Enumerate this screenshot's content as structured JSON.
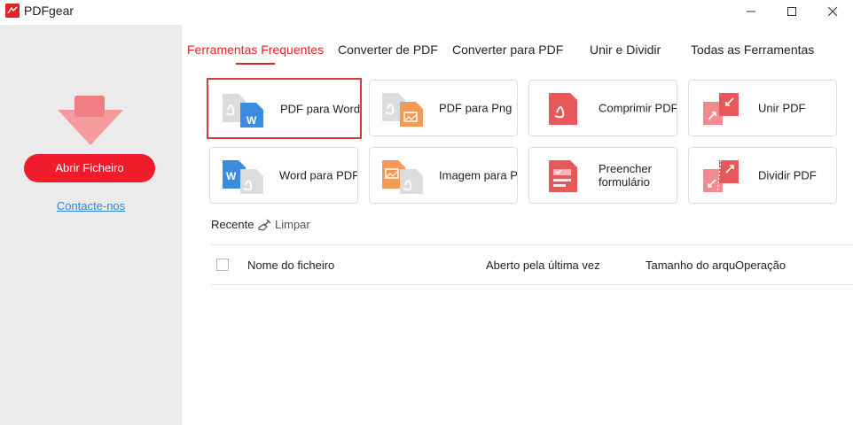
{
  "app": {
    "title": "PDFgear"
  },
  "window_controls": {
    "minimize": "—",
    "maximize": "☐",
    "close": "✕"
  },
  "sidebar": {
    "open_button": "Abrir Ficheiro",
    "contact_link": "Contacte-nos",
    "icon": "download-arrow-icon"
  },
  "tabs": [
    {
      "label": "Ferramentas Frequentes",
      "active": true
    },
    {
      "label": "Converter de PDF",
      "active": false
    },
    {
      "label": "Converter para PDF",
      "active": false
    },
    {
      "label": "Unir e Dividir",
      "active": false
    },
    {
      "label": "Todas as Ferramentas",
      "active": false
    }
  ],
  "tools": [
    {
      "label": "PDF para Word",
      "icon": "pdf-to-word-icon",
      "selected": true
    },
    {
      "label": "PDF para Png",
      "icon": "pdf-to-png-icon"
    },
    {
      "label": "Comprimir PDF",
      "icon": "compress-pdf-icon"
    },
    {
      "label": "Unir PDF",
      "icon": "merge-pdf-icon"
    },
    {
      "label": "Word para PDF",
      "icon": "word-to-pdf-icon"
    },
    {
      "label": "Imagem para PDF",
      "icon": "image-to-pdf-icon"
    },
    {
      "label": "Preencher formulário",
      "icon": "fill-form-icon"
    },
    {
      "label": "Dividir PDF",
      "icon": "split-pdf-icon"
    }
  ],
  "recent": {
    "label": "Recente",
    "clear_label": "Limpar",
    "clear_icon": "broom-icon",
    "columns": [
      "Nome do ficheiro",
      "Aberto pela última vez",
      "Tamanho do arquivo",
      "Operação"
    ]
  },
  "colors": {
    "accent": "#f01c2c",
    "link": "#2f86d6",
    "word_blue": "#3b8be0",
    "png_orange": "#f49a55",
    "pdf_red": "#e8575a"
  }
}
